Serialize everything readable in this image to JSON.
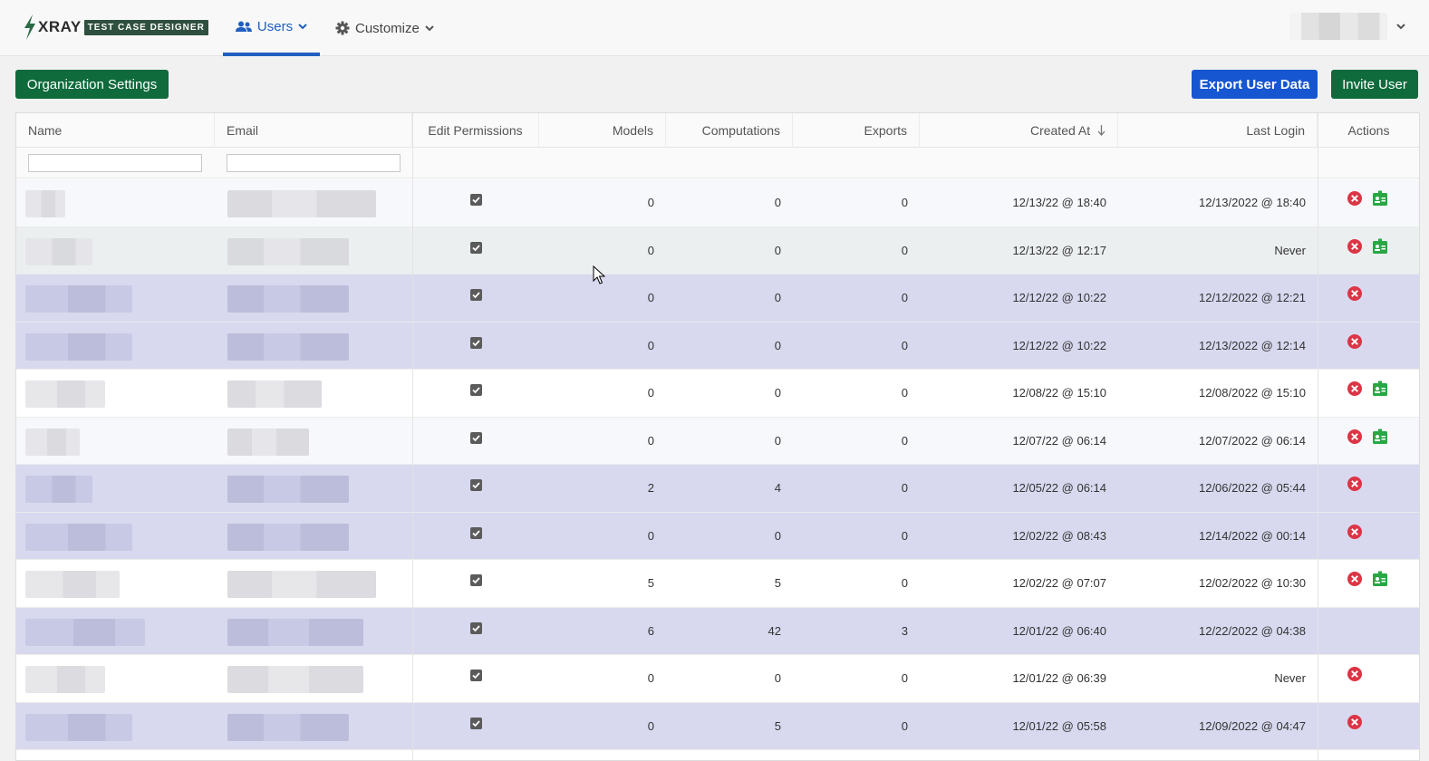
{
  "app": {
    "logo_word": "XRAY",
    "logo_tag": "TEST CASE DESIGNER"
  },
  "nav": {
    "users": "Users",
    "customize": "Customize"
  },
  "toolbar": {
    "org_settings": "Organization Settings",
    "export": "Export User Data",
    "invite": "Invite User"
  },
  "table": {
    "columns": {
      "name": "Name",
      "email": "Email",
      "edit_permissions": "Edit Permissions",
      "models": "Models",
      "computations": "Computations",
      "exports": "Exports",
      "created_at": "Created At",
      "last_login": "Last Login",
      "actions": "Actions"
    },
    "sort": {
      "column": "created_at",
      "direction": "descending"
    },
    "rows": [
      {
        "models": "0",
        "computations": "0",
        "exports": "0",
        "created": "12/13/22 @ 18:40",
        "last_login": "12/13/2022 @ 18:40",
        "edit": true,
        "delete": true,
        "badge": true
      },
      {
        "models": "0",
        "computations": "0",
        "exports": "0",
        "created": "12/13/22 @ 12:17",
        "last_login": "Never",
        "edit": true,
        "delete": true,
        "badge": true
      },
      {
        "models": "0",
        "computations": "0",
        "exports": "0",
        "created": "12/12/22 @ 10:22",
        "last_login": "12/12/2022 @ 12:21",
        "edit": true,
        "delete": true,
        "badge": false
      },
      {
        "models": "0",
        "computations": "0",
        "exports": "0",
        "created": "12/12/22 @ 10:22",
        "last_login": "12/13/2022 @ 12:14",
        "edit": true,
        "delete": true,
        "badge": false
      },
      {
        "models": "0",
        "computations": "0",
        "exports": "0",
        "created": "12/08/22 @ 15:10",
        "last_login": "12/08/2022 @ 15:10",
        "edit": true,
        "delete": true,
        "badge": true
      },
      {
        "models": "0",
        "computations": "0",
        "exports": "0",
        "created": "12/07/22 @ 06:14",
        "last_login": "12/07/2022 @ 06:14",
        "edit": true,
        "delete": true,
        "badge": true
      },
      {
        "models": "2",
        "computations": "4",
        "exports": "0",
        "created": "12/05/22 @ 06:14",
        "last_login": "12/06/2022 @ 05:44",
        "edit": true,
        "delete": true,
        "badge": false
      },
      {
        "models": "0",
        "computations": "0",
        "exports": "0",
        "created": "12/02/22 @ 08:43",
        "last_login": "12/14/2022 @ 00:14",
        "edit": true,
        "delete": true,
        "badge": false
      },
      {
        "models": "5",
        "computations": "5",
        "exports": "0",
        "created": "12/02/22 @ 07:07",
        "last_login": "12/02/2022 @ 10:30",
        "edit": true,
        "delete": true,
        "badge": true
      },
      {
        "models": "6",
        "computations": "42",
        "exports": "3",
        "created": "12/01/22 @ 06:40",
        "last_login": "12/22/2022 @ 04:38",
        "edit": true,
        "delete": false,
        "badge": false
      },
      {
        "models": "0",
        "computations": "0",
        "exports": "0",
        "created": "12/01/22 @ 06:39",
        "last_login": "Never",
        "edit": true,
        "delete": true,
        "badge": false
      },
      {
        "models": "0",
        "computations": "5",
        "exports": "0",
        "created": "12/01/22 @ 05:58",
        "last_login": "12/09/2022 @ 04:47",
        "edit": true,
        "delete": true,
        "badge": false
      }
    ]
  },
  "colors": {
    "accent": "#1f5fbf",
    "primary_green": "#0f6a3c",
    "export_blue": "#1656d1",
    "selected_row": "#d8d9ef",
    "delete_red": "#dc3545",
    "badge_green": "#28a745"
  }
}
